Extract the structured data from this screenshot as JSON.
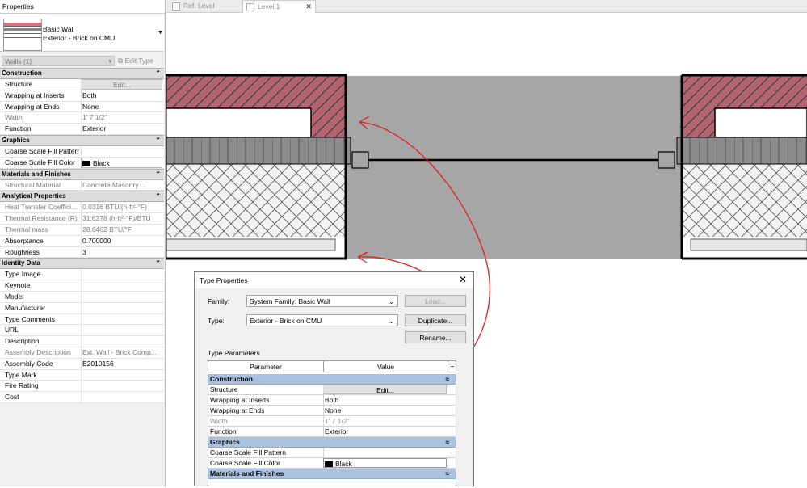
{
  "properties": {
    "title": "Properties",
    "type_family": "Basic Wall",
    "type_name": "Exterior - Brick on CMU",
    "instance_selector": "Walls (1)",
    "edit_type": "Edit Type",
    "groups": [
      {
        "name": "Construction",
        "rows": [
          {
            "key": "Structure",
            "value": "Edit...",
            "button": true
          },
          {
            "key": "Wrapping at Inserts",
            "value": "Both"
          },
          {
            "key": "Wrapping at Ends",
            "value": "None"
          },
          {
            "key": "Width",
            "value": "1'  7 1/2\"",
            "dim": true
          },
          {
            "key": "Function",
            "value": "Exterior"
          }
        ]
      },
      {
        "name": "Graphics",
        "rows": [
          {
            "key": "Coarse Scale Fill Pattern",
            "value": ""
          },
          {
            "key": "Coarse Scale Fill Color",
            "value": "Black",
            "color": "#000000"
          }
        ]
      },
      {
        "name": "Materials and Finishes",
        "rows": [
          {
            "key": "Structural Material",
            "value": "Concrete Masonry ...",
            "dim": true
          }
        ]
      },
      {
        "name": "Analytical Properties",
        "rows": [
          {
            "key": "Heat Transfer Coeffici...",
            "value": "0.0316 BTU/(h·ft²·°F)",
            "dim": true
          },
          {
            "key": "Thermal Resistance (R)",
            "value": "31.6278 (h·ft²·°F)/BTU",
            "dim": true
          },
          {
            "key": "Thermal mass",
            "value": "28.6462 BTU/°F",
            "dim": true
          },
          {
            "key": "Absorptance",
            "value": "0.700000"
          },
          {
            "key": "Roughness",
            "value": "3"
          }
        ]
      },
      {
        "name": "Identity Data",
        "rows": [
          {
            "key": "Type Image",
            "value": ""
          },
          {
            "key": "Keynote",
            "value": ""
          },
          {
            "key": "Model",
            "value": ""
          },
          {
            "key": "Manufacturer",
            "value": ""
          },
          {
            "key": "Type Comments",
            "value": ""
          },
          {
            "key": "URL",
            "value": ""
          },
          {
            "key": "Description",
            "value": ""
          },
          {
            "key": "Assembly Description",
            "value": "Ext. Wall - Brick Comp...",
            "dim": true
          },
          {
            "key": "Assembly Code",
            "value": "B2010156"
          },
          {
            "key": "Type Mark",
            "value": ""
          },
          {
            "key": "Fire Rating",
            "value": ""
          },
          {
            "key": "Cost",
            "value": ""
          }
        ]
      }
    ]
  },
  "tabs": [
    {
      "label": "Ref. Level",
      "active": false
    },
    {
      "label": "Level 1",
      "active": true
    }
  ],
  "dialog": {
    "title": "Type Properties",
    "close": "✕",
    "family_label": "Family:",
    "family_value": "System Family: Basic Wall",
    "type_label": "Type:",
    "type_value": "Exterior - Brick on CMU",
    "load": "Load...",
    "duplicate": "Duplicate...",
    "rename": "Rename...",
    "section_label": "Type Parameters",
    "col_parameter": "Parameter",
    "col_value": "Value",
    "col_eq": "=",
    "groups": [
      {
        "name": "Construction",
        "rows": [
          {
            "key": "Structure",
            "value": "Edit...",
            "button": true
          },
          {
            "key": "Wrapping at Inserts",
            "value": "Both"
          },
          {
            "key": "Wrapping at Ends",
            "value": "None"
          },
          {
            "key": "Width",
            "value": "1'  7 1/2\"",
            "dim": true
          },
          {
            "key": "Function",
            "value": "Exterior"
          }
        ]
      },
      {
        "name": "Graphics",
        "rows": [
          {
            "key": "Coarse Scale Fill Pattern",
            "value": ""
          },
          {
            "key": "Coarse Scale Fill Color",
            "value": "Black",
            "color": "#000000"
          }
        ]
      },
      {
        "name": "Materials and Finishes",
        "rows": []
      }
    ]
  },
  "colors": {
    "brick": "#b36470",
    "core_grey": "#a6a6a6",
    "group_blue": "#a9c2df",
    "highlight": "#ffff33",
    "annotation_red": "#e02020"
  }
}
